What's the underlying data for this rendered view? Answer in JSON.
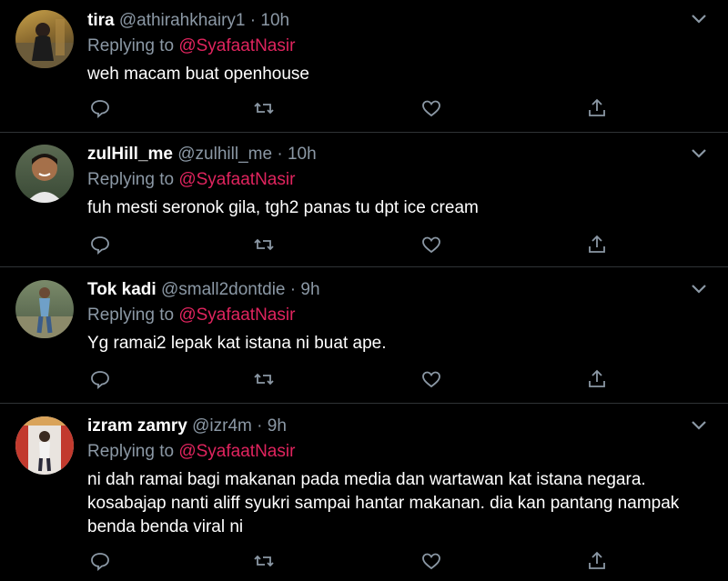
{
  "replying_label": "Replying to",
  "icons": {
    "reply": "reply-icon",
    "retweet": "retweet-icon",
    "like": "heart-icon",
    "share": "share-icon",
    "more": "chevron-down-icon"
  },
  "colors": {
    "background": "#000000",
    "mention": "#e0245e",
    "muted": "#8b98a5",
    "divider": "#2f3336"
  },
  "tweets": [
    {
      "name": "tira",
      "handle": "@athirahkhairy1",
      "separator": "·",
      "time": "10h",
      "reply_to": "@SyafaatNasir",
      "text": "weh macam buat openhouse"
    },
    {
      "name": "zulHill_me",
      "handle": "@zulhill_me",
      "separator": "·",
      "time": "10h",
      "reply_to": "@SyafaatNasir",
      "text": "fuh mesti seronok gila, tgh2 panas tu dpt ice cream"
    },
    {
      "name": "Tok kadi",
      "handle": "@small2dontdie",
      "separator": "·",
      "time": "9h",
      "reply_to": "@SyafaatNasir",
      "text": "Yg ramai2 lepak kat istana ni buat ape."
    },
    {
      "name": "izram zamry",
      "handle": "@izr4m",
      "separator": "·",
      "time": "9h",
      "reply_to": "@SyafaatNasir",
      "text_lines": [
        "ni dah ramai bagi makanan pada media dan wartawan kat istana negara.",
        "kosabajap nanti aliff syukri sampai hantar makanan. dia kan pantang nampak",
        "benda benda viral ni"
      ]
    }
  ]
}
